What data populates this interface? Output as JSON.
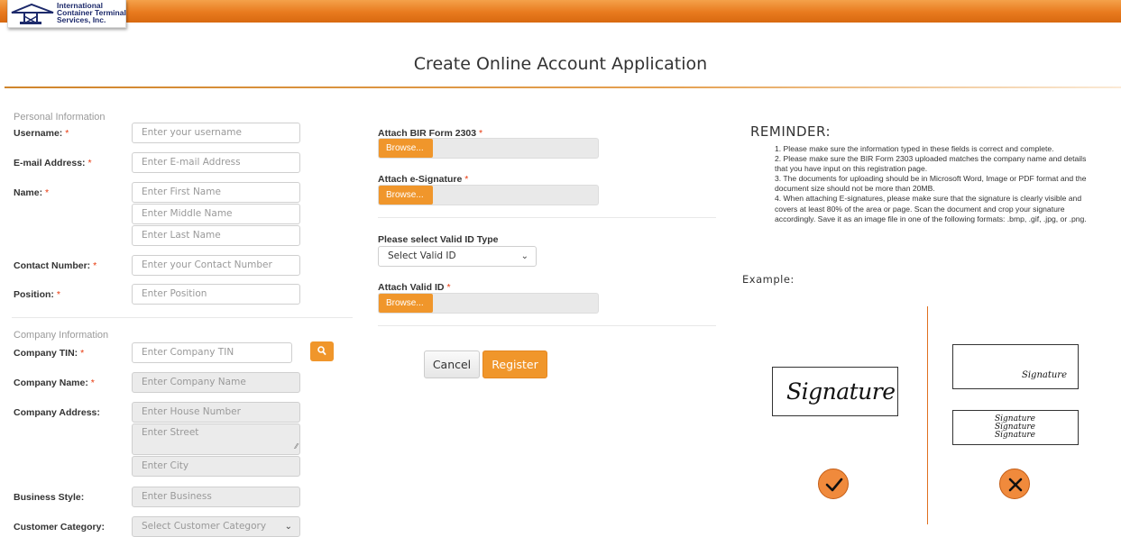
{
  "header": {
    "company_line1": "International",
    "company_line2": "Container Terminal",
    "company_line3": "Services, Inc.",
    "page_title": "Create Online Account Application"
  },
  "personal": {
    "section_title": "Personal Information",
    "username_label": "Username:",
    "username_placeholder": "Enter your username",
    "email_label": "E-mail Address:",
    "email_placeholder": "Enter E-mail Address",
    "name_label": "Name:",
    "first_name_placeholder": "Enter First Name",
    "middle_name_placeholder": "Enter Middle Name",
    "last_name_placeholder": "Enter Last Name",
    "contact_label": "Contact Number:",
    "contact_placeholder": "Enter your Contact Number",
    "position_label": "Position:",
    "position_placeholder": "Enter Position"
  },
  "company": {
    "section_title": "Company Information",
    "tin_label": "Company TIN:",
    "tin_placeholder": "Enter Company TIN",
    "name_label": "Company Name:",
    "name_placeholder": "Enter Company Name",
    "address_label": "Company Address:",
    "house_placeholder": "Enter House Number",
    "street_placeholder": "Enter Street",
    "city_placeholder": "Enter City",
    "business_label": "Business Style:",
    "business_placeholder": "Enter Business",
    "category_label": "Customer Category:",
    "category_value": "Select Customer Category"
  },
  "attachments": {
    "bir_label": "Attach BIR Form 2303",
    "esig_label": "Attach e-Signature",
    "valid_id_type_label": "Please select Valid ID Type",
    "valid_id_type_value": "Select Valid ID",
    "valid_id_label": "Attach Valid ID",
    "browse_label": "Browse..."
  },
  "required_mark": "*",
  "actions": {
    "cancel_label": "Cancel",
    "register_label": "Register"
  },
  "reminder": {
    "title": "REMINDER:",
    "items": [
      "1. Please make sure the information typed in these fields is correct and complete.",
      "2. Please make sure the BIR Form 2303 uploaded matches the company name and details that you have input on this registration page.",
      "3. The documents for uploading should be in Microsoft Word, Image or PDF format and the document size should not be more than 20MB.",
      "4. When attaching E-signatures, please make sure that the signature is clearly visible and covers at least 80% of the area or page. Scan the document and crop your signature accordingly. Save it as an image file in one of the following formats: .bmp, .gif, .jpg, or .png."
    ],
    "example_label": "Example:",
    "signature_text": "Signature"
  },
  "colors": {
    "accent": "#f0962b",
    "header_orange": "#e87a1e",
    "required": "#e8380d",
    "logo_blue": "#1d2a6b"
  },
  "icons": {
    "search": "search-icon",
    "check": "check-icon",
    "cross": "x-icon",
    "chevron": "chevron-down-icon"
  }
}
